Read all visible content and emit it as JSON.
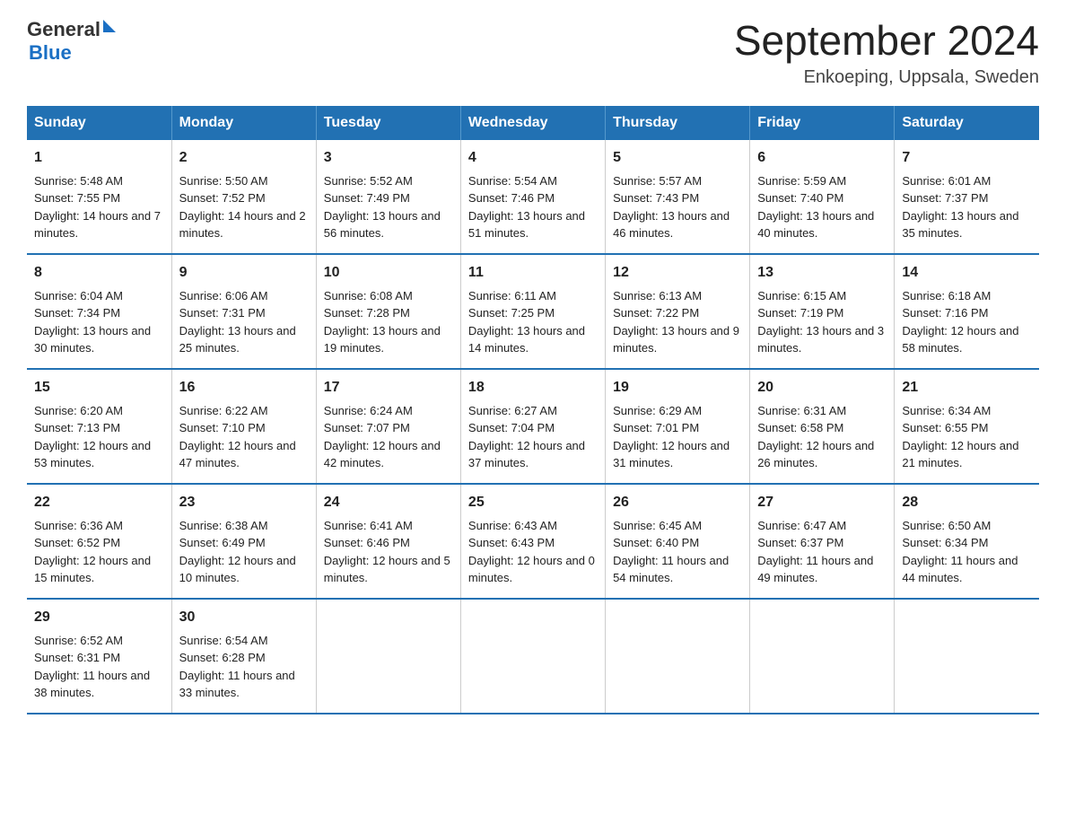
{
  "logo": {
    "text_general": "General",
    "text_blue": "Blue",
    "triangle": "▶"
  },
  "title": "September 2024",
  "location": "Enkoeping, Uppsala, Sweden",
  "days_of_week": [
    "Sunday",
    "Monday",
    "Tuesday",
    "Wednesday",
    "Thursday",
    "Friday",
    "Saturday"
  ],
  "weeks": [
    [
      {
        "day": "1",
        "sunrise": "5:48 AM",
        "sunset": "7:55 PM",
        "daylight": "14 hours and 7 minutes."
      },
      {
        "day": "2",
        "sunrise": "5:50 AM",
        "sunset": "7:52 PM",
        "daylight": "14 hours and 2 minutes."
      },
      {
        "day": "3",
        "sunrise": "5:52 AM",
        "sunset": "7:49 PM",
        "daylight": "13 hours and 56 minutes."
      },
      {
        "day": "4",
        "sunrise": "5:54 AM",
        "sunset": "7:46 PM",
        "daylight": "13 hours and 51 minutes."
      },
      {
        "day": "5",
        "sunrise": "5:57 AM",
        "sunset": "7:43 PM",
        "daylight": "13 hours and 46 minutes."
      },
      {
        "day": "6",
        "sunrise": "5:59 AM",
        "sunset": "7:40 PM",
        "daylight": "13 hours and 40 minutes."
      },
      {
        "day": "7",
        "sunrise": "6:01 AM",
        "sunset": "7:37 PM",
        "daylight": "13 hours and 35 minutes."
      }
    ],
    [
      {
        "day": "8",
        "sunrise": "6:04 AM",
        "sunset": "7:34 PM",
        "daylight": "13 hours and 30 minutes."
      },
      {
        "day": "9",
        "sunrise": "6:06 AM",
        "sunset": "7:31 PM",
        "daylight": "13 hours and 25 minutes."
      },
      {
        "day": "10",
        "sunrise": "6:08 AM",
        "sunset": "7:28 PM",
        "daylight": "13 hours and 19 minutes."
      },
      {
        "day": "11",
        "sunrise": "6:11 AM",
        "sunset": "7:25 PM",
        "daylight": "13 hours and 14 minutes."
      },
      {
        "day": "12",
        "sunrise": "6:13 AM",
        "sunset": "7:22 PM",
        "daylight": "13 hours and 9 minutes."
      },
      {
        "day": "13",
        "sunrise": "6:15 AM",
        "sunset": "7:19 PM",
        "daylight": "13 hours and 3 minutes."
      },
      {
        "day": "14",
        "sunrise": "6:18 AM",
        "sunset": "7:16 PM",
        "daylight": "12 hours and 58 minutes."
      }
    ],
    [
      {
        "day": "15",
        "sunrise": "6:20 AM",
        "sunset": "7:13 PM",
        "daylight": "12 hours and 53 minutes."
      },
      {
        "day": "16",
        "sunrise": "6:22 AM",
        "sunset": "7:10 PM",
        "daylight": "12 hours and 47 minutes."
      },
      {
        "day": "17",
        "sunrise": "6:24 AM",
        "sunset": "7:07 PM",
        "daylight": "12 hours and 42 minutes."
      },
      {
        "day": "18",
        "sunrise": "6:27 AM",
        "sunset": "7:04 PM",
        "daylight": "12 hours and 37 minutes."
      },
      {
        "day": "19",
        "sunrise": "6:29 AM",
        "sunset": "7:01 PM",
        "daylight": "12 hours and 31 minutes."
      },
      {
        "day": "20",
        "sunrise": "6:31 AM",
        "sunset": "6:58 PM",
        "daylight": "12 hours and 26 minutes."
      },
      {
        "day": "21",
        "sunrise": "6:34 AM",
        "sunset": "6:55 PM",
        "daylight": "12 hours and 21 minutes."
      }
    ],
    [
      {
        "day": "22",
        "sunrise": "6:36 AM",
        "sunset": "6:52 PM",
        "daylight": "12 hours and 15 minutes."
      },
      {
        "day": "23",
        "sunrise": "6:38 AM",
        "sunset": "6:49 PM",
        "daylight": "12 hours and 10 minutes."
      },
      {
        "day": "24",
        "sunrise": "6:41 AM",
        "sunset": "6:46 PM",
        "daylight": "12 hours and 5 minutes."
      },
      {
        "day": "25",
        "sunrise": "6:43 AM",
        "sunset": "6:43 PM",
        "daylight": "12 hours and 0 minutes."
      },
      {
        "day": "26",
        "sunrise": "6:45 AM",
        "sunset": "6:40 PM",
        "daylight": "11 hours and 54 minutes."
      },
      {
        "day": "27",
        "sunrise": "6:47 AM",
        "sunset": "6:37 PM",
        "daylight": "11 hours and 49 minutes."
      },
      {
        "day": "28",
        "sunrise": "6:50 AM",
        "sunset": "6:34 PM",
        "daylight": "11 hours and 44 minutes."
      }
    ],
    [
      {
        "day": "29",
        "sunrise": "6:52 AM",
        "sunset": "6:31 PM",
        "daylight": "11 hours and 38 minutes."
      },
      {
        "day": "30",
        "sunrise": "6:54 AM",
        "sunset": "6:28 PM",
        "daylight": "11 hours and 33 minutes."
      },
      null,
      null,
      null,
      null,
      null
    ]
  ],
  "labels": {
    "sunrise": "Sunrise:",
    "sunset": "Sunset:",
    "daylight": "Daylight:"
  }
}
